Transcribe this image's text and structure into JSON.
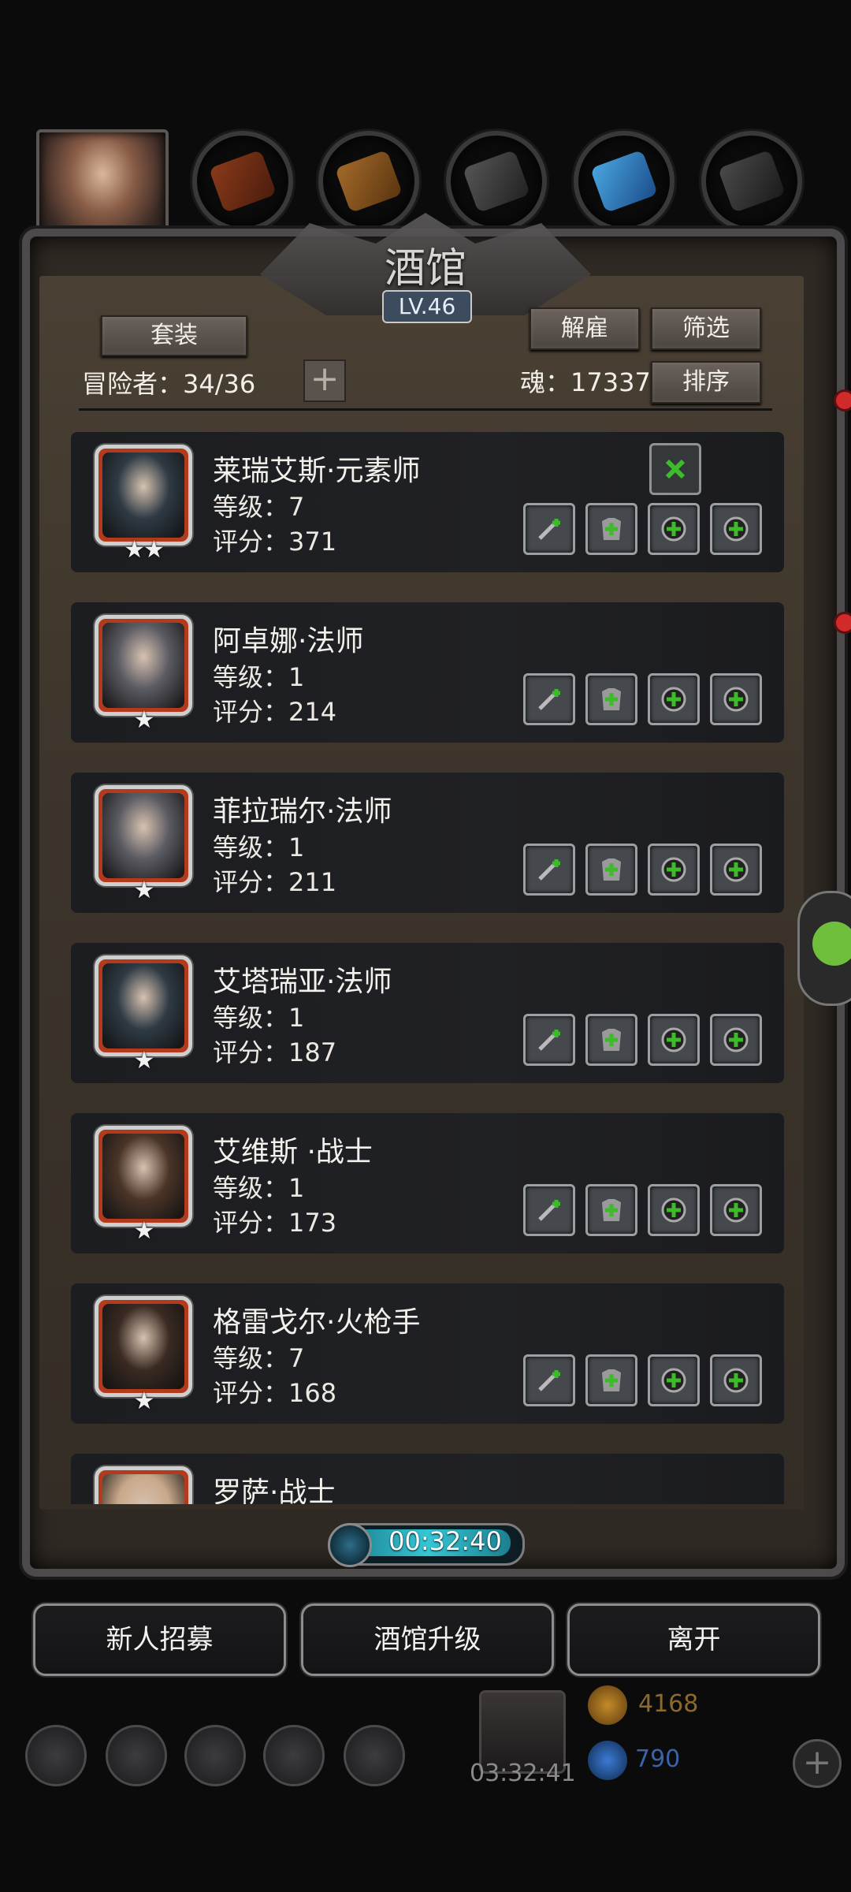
{
  "title": "酒馆",
  "level": "LV.46",
  "buttons": {
    "set": "套装",
    "dismiss": "解雇",
    "filter": "筛选",
    "sort": "排序",
    "recruit": "新人招募",
    "upgrade": "酒馆升级",
    "leave": "离开"
  },
  "adventurers": {
    "label": "冒险者：34/36"
  },
  "soul": {
    "label": "魂：17337"
  },
  "heroes": [
    {
      "name": "莱瑞艾斯·元素师",
      "level": "等级：7",
      "score": "评分：371",
      "stars": "★★",
      "face": "#2e3a44"
    },
    {
      "name": "阿卓娜·法师",
      "level": "等级：1",
      "score": "评分：214",
      "stars": "★",
      "face": "#5a5a62"
    },
    {
      "name": "菲拉瑞尔·法师",
      "level": "等级：1",
      "score": "评分：211",
      "stars": "★",
      "face": "#5a5a62"
    },
    {
      "name": "艾塔瑞亚·法师",
      "level": "等级：1",
      "score": "评分：187",
      "stars": "★",
      "face": "#2e3a44"
    },
    {
      "name": "艾维斯 ·战士",
      "level": "等级：1",
      "score": "评分：173",
      "stars": "★",
      "face": "#4a3428"
    },
    {
      "name": "格雷戈尔·火枪手",
      "level": "等级：7",
      "score": "评分：168",
      "stars": "★",
      "face": "#3a2a22"
    },
    {
      "name": "罗萨·战士",
      "level": "",
      "score": "",
      "stars": "",
      "face": "#c9a88a"
    }
  ],
  "timer": "00:32:40",
  "gift_timer": "03:32:41",
  "gold": "4168",
  "gems": "790",
  "colors": {
    "accent_green": "#3dbb2a",
    "timer_cyan": "#35c6d6",
    "gold": "#c58a2a",
    "gem": "#3a7bd5"
  }
}
